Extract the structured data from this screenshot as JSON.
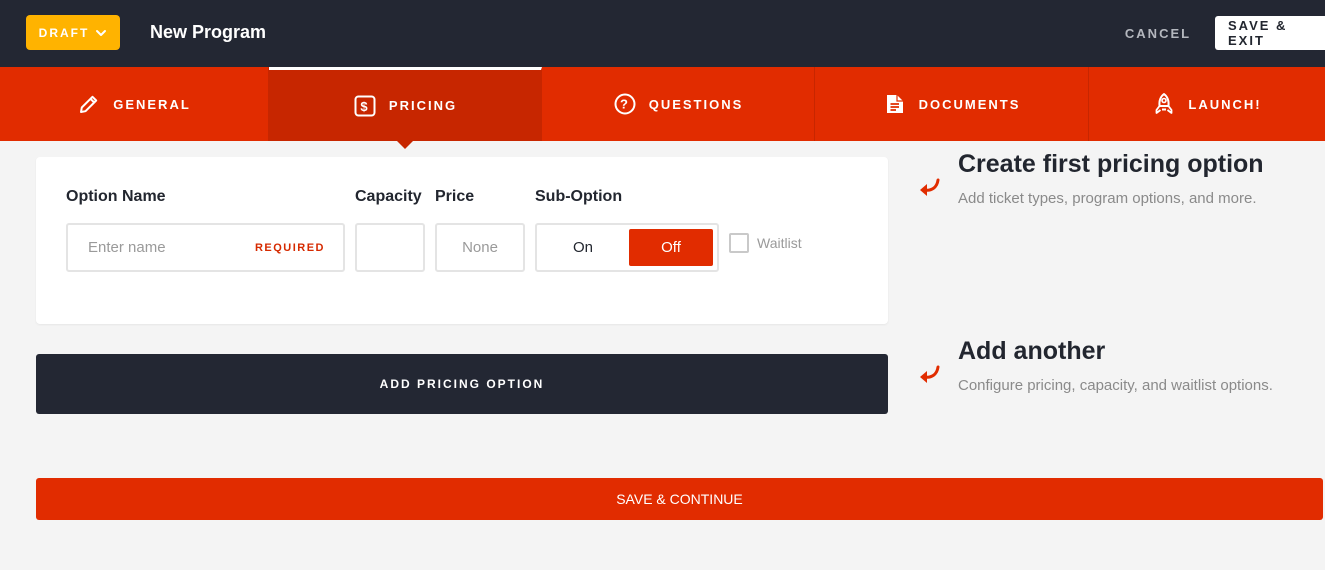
{
  "header": {
    "status_label": "DRAFT",
    "title": "New Program",
    "cancel_label": "CANCEL",
    "save_exit_label": "SAVE & EXIT"
  },
  "tabs": [
    {
      "label": "GENERAL",
      "icon": "pencil-icon",
      "active": false
    },
    {
      "label": "PRICING",
      "icon": "dollar-icon",
      "active": true
    },
    {
      "label": "QUESTIONS",
      "icon": "question-icon",
      "active": false
    },
    {
      "label": "DOCUMENTS",
      "icon": "document-icon",
      "active": false
    },
    {
      "label": "LAUNCH!",
      "icon": "rocket-icon",
      "active": false
    }
  ],
  "pricing_form": {
    "option_name_label": "Option Name",
    "option_name_placeholder": "Enter name",
    "option_name_value": "",
    "required_label": "REQUIRED",
    "capacity_label": "Capacity",
    "capacity_value": "",
    "price_label": "Price",
    "price_placeholder": "None",
    "price_value": "",
    "sub_option_label": "Sub-Option",
    "sub_option_on": "On",
    "sub_option_off": "Off",
    "sub_option_selected": "Off",
    "waitlist_label": "Waitlist",
    "waitlist_checked": false
  },
  "add_pricing_label": "ADD PRICING OPTION",
  "hints": [
    {
      "title": "Create first pricing option",
      "description": "Add ticket types, program options, and more."
    },
    {
      "title": "Add another",
      "description": "Configure pricing, capacity, and waitlist options."
    }
  ],
  "save_continue_label": "SAVE & CONTINUE",
  "colors": {
    "header_bg": "#232733",
    "accent_red": "#e12c00",
    "draft_yellow": "#ffb300",
    "page_bg": "#f4f4f4"
  }
}
